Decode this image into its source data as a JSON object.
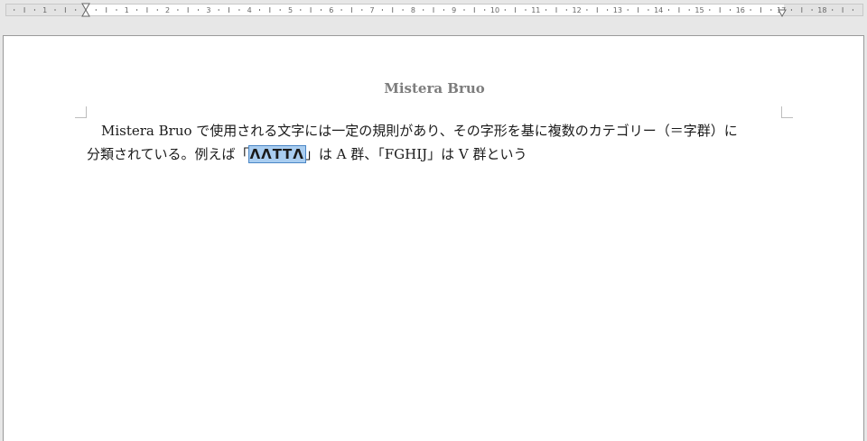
{
  "ruler": {
    "numbers": [
      "1",
      "1",
      "2",
      "3",
      "4",
      "5",
      "6",
      "7",
      "8",
      "9",
      "10",
      "11",
      "12",
      "13",
      "14",
      "15",
      "16",
      "17",
      "18"
    ]
  },
  "document": {
    "title": "Mistera Bruo",
    "line1": "Mistera Bruo で使用される文字には一定の規則があり、その字形を基に複数のカテゴリー（＝字群）に",
    "line2_before": "分類されている。例えば「",
    "line2_selected": "ꓥꓥꓔꓔꓥ",
    "line2_after": "」は A 群、「FGHIJ」は V 群という"
  }
}
